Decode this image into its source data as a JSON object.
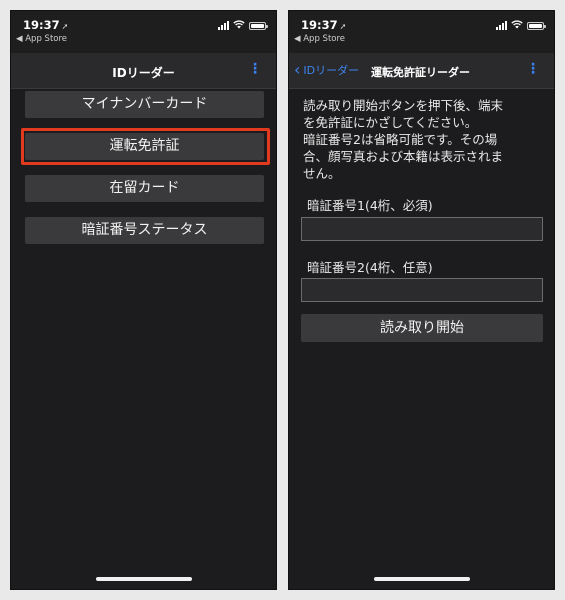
{
  "status_bar": {
    "time": "19:37",
    "back_app": "◀ App Store"
  },
  "left": {
    "nav_title": "IDリーダー",
    "more_icon": "⋮",
    "menu": [
      {
        "label": "マイナンバーカード"
      },
      {
        "label": "運転免許証"
      },
      {
        "label": "在留カード"
      },
      {
        "label": "暗証番号ステータス"
      }
    ],
    "highlight_color": "#e23a1f"
  },
  "right": {
    "back_label": "IDリーダー",
    "nav_title": "運転免許証リーダー",
    "more_icon": "⋮",
    "description": "読み取り開始ボタンを押下後、端末\nを免許証にかざしてください。\n暗証番号2は省略可能です。その場\n合、顔写真および本籍は表示されま\nせん。",
    "pin1_label": "暗証番号1(4桁、必須)",
    "pin1_value": "",
    "pin2_label": "暗証番号2(4桁、任意)",
    "pin2_value": "",
    "start_button": "読み取り開始"
  }
}
